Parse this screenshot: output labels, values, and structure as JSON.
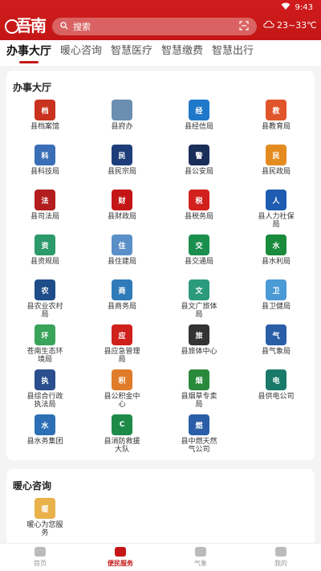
{
  "status": {
    "time": "9:43"
  },
  "header": {
    "logo_text": "吾南",
    "search_placeholder": "搜索",
    "weather": "23~33℃"
  },
  "tabs": [
    {
      "label": "办事大厅",
      "active": true
    },
    {
      "label": "暖心咨询",
      "active": false
    },
    {
      "label": "智慧医疗",
      "active": false
    },
    {
      "label": "智慧缴费",
      "active": false
    },
    {
      "label": "智慧出行",
      "active": false
    }
  ],
  "hall": {
    "title": "办事大厅",
    "items": [
      {
        "label": "县档案馆",
        "icon": "archive-icon",
        "color": "#c8321e",
        "glyph": "档"
      },
      {
        "label": "县府办",
        "icon": "building-icon",
        "color": "#6a8fb0",
        "glyph": ""
      },
      {
        "label": "县经信局",
        "icon": "economy-icon",
        "color": "#1f78c8",
        "glyph": "经"
      },
      {
        "label": "县教育局",
        "icon": "education-icon",
        "color": "#e0552a",
        "glyph": "教"
      },
      {
        "label": "县科技局",
        "icon": "science-icon",
        "color": "#3a6fb7",
        "glyph": "科"
      },
      {
        "label": "县民宗局",
        "icon": "ethnic-icon",
        "color": "#1d3e7a",
        "glyph": "民"
      },
      {
        "label": "县公安局",
        "icon": "police-icon",
        "color": "#1a2e5a",
        "glyph": "警"
      },
      {
        "label": "县民政局",
        "icon": "civil-affairs-icon",
        "color": "#e38b1e",
        "glyph": "民"
      },
      {
        "label": "县司法局",
        "icon": "justice-icon",
        "color": "#b21d1d",
        "glyph": "法"
      },
      {
        "label": "县财政局",
        "icon": "finance-icon",
        "color": "#c41616",
        "glyph": "财"
      },
      {
        "label": "县税务局",
        "icon": "tax-icon",
        "color": "#d2201d",
        "glyph": "税"
      },
      {
        "label": "县人力社保局",
        "icon": "hr-icon",
        "color": "#1d5cb0",
        "glyph": "人"
      },
      {
        "label": "县资规局",
        "icon": "resources-icon",
        "color": "#2c9a6a",
        "glyph": "资"
      },
      {
        "label": "县住建局",
        "icon": "housing-icon",
        "color": "#5b8fc7",
        "glyph": "住"
      },
      {
        "label": "县交通局",
        "icon": "transport-icon",
        "color": "#1a8f4d",
        "glyph": "交"
      },
      {
        "label": "县水利局",
        "icon": "water-icon",
        "color": "#1a8a3c",
        "glyph": "水"
      },
      {
        "label": "县农业农村局",
        "icon": "agriculture-icon",
        "color": "#1f4d8a",
        "glyph": "农"
      },
      {
        "label": "县商务局",
        "icon": "commerce-icon",
        "color": "#2f7ab8",
        "glyph": "商"
      },
      {
        "label": "县文广旅体局",
        "icon": "culture-icon",
        "color": "#2c9a7d",
        "glyph": "文"
      },
      {
        "label": "县卫健局",
        "icon": "health-icon",
        "color": "#4a9ad6",
        "glyph": "卫"
      },
      {
        "label": "苍南生态环境局",
        "icon": "ecology-icon",
        "color": "#3aa35a",
        "glyph": "环"
      },
      {
        "label": "县应急管理局",
        "icon": "emergency-icon",
        "color": "#d0201b",
        "glyph": "应"
      },
      {
        "label": "县旅体中心",
        "icon": "tourism-icon",
        "color": "#333333",
        "glyph": "旅"
      },
      {
        "label": "县气象局",
        "icon": "weather-bureau-icon",
        "color": "#2a5fa8",
        "glyph": "气"
      },
      {
        "label": "县综合行政执法局",
        "icon": "enforcement-icon",
        "color": "#2a4e8e",
        "glyph": "执"
      },
      {
        "label": "县公积金中心",
        "icon": "fund-icon",
        "color": "#e07b2a",
        "glyph": "积"
      },
      {
        "label": "县烟草专卖局",
        "icon": "tobacco-icon",
        "color": "#2a8a3c",
        "glyph": "烟"
      },
      {
        "label": "县供电公司",
        "icon": "power-icon",
        "color": "#1a7a6a",
        "glyph": "电"
      },
      {
        "label": "县水务集团",
        "icon": "water-group-icon",
        "color": "#2d6fb5",
        "glyph": "水"
      },
      {
        "label": "县消防救援大队",
        "icon": "fire-icon",
        "color": "#1e8a4a",
        "glyph": "C"
      },
      {
        "label": "县中燃天然气公司",
        "icon": "gas-icon",
        "color": "#2a5ea8",
        "glyph": "燃"
      }
    ]
  },
  "consult": {
    "title": "暖心咨询",
    "items": [
      {
        "label": "暖心为您服务",
        "icon": "service-icon",
        "color": "#e8b14a",
        "glyph": "暖"
      }
    ]
  },
  "bottom_nav": [
    {
      "label": "首页",
      "icon": "home-icon",
      "active": false
    },
    {
      "label": "便民服务",
      "icon": "heart-icon",
      "active": true
    },
    {
      "label": "气象",
      "icon": "weather-nav-icon",
      "active": false
    },
    {
      "label": "我的",
      "icon": "profile-icon",
      "active": false
    }
  ]
}
